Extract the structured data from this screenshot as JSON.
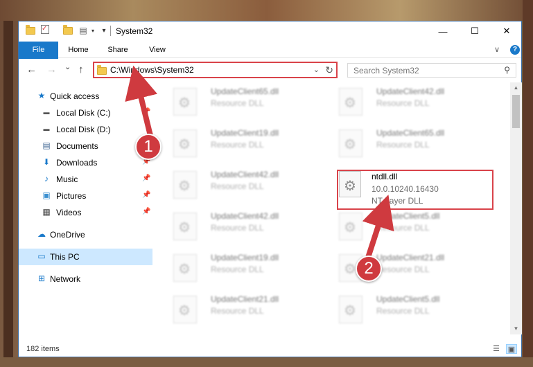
{
  "window": {
    "title": "System32",
    "minimize_label": "—",
    "maximize_label": "☐",
    "close_label": "✕"
  },
  "ribbon": {
    "tabs": [
      "File",
      "Home",
      "Share",
      "View"
    ],
    "help_label": "?",
    "collapse_label": "∨"
  },
  "nav": {
    "back_label": "←",
    "forward_label": "→",
    "recent_label": "⌄",
    "up_label": "↑",
    "address": "C:\\Windows\\System32",
    "dropdown_label": "⌄",
    "refresh_label": "↻",
    "search_placeholder": "Search System32",
    "search_icon_label": "⚲"
  },
  "sidebar": {
    "items": [
      {
        "label": "Quick access",
        "icon": "★"
      },
      {
        "label": "Local Disk (C:)",
        "icon": "▬"
      },
      {
        "label": "Local Disk (D:)",
        "icon": "▬"
      },
      {
        "label": "Documents",
        "icon": "▤"
      },
      {
        "label": "Downloads",
        "icon": "⬇"
      },
      {
        "label": "Music",
        "icon": "♪"
      },
      {
        "label": "Pictures",
        "icon": "▣"
      },
      {
        "label": "Videos",
        "icon": "▦"
      },
      {
        "label": "OneDrive",
        "icon": "☁"
      },
      {
        "label": "This PC",
        "icon": "▭"
      },
      {
        "label": "Network",
        "icon": "⊞"
      }
    ],
    "pin_label": "📌"
  },
  "files": [
    {
      "name": "UpdateClient65.dll",
      "desc": "Resource DLL"
    },
    {
      "name": "UpdateClient42.dll",
      "desc": "Resource DLL"
    },
    {
      "name": "UpdateClient19.dll",
      "desc": "Resource DLL"
    },
    {
      "name": "UpdateClient65.dll",
      "desc": "Resource DLL"
    },
    {
      "name": "UpdateClient42.dll",
      "desc": "Resource DLL"
    },
    {
      "name": "ntdll.dll",
      "desc": "10.0.10240.16430",
      "desc2": "NT Layer DLL"
    },
    {
      "name": "UpdateClient42.dll",
      "desc": "Resource DLL"
    },
    {
      "name": "UpdateClient5.dll",
      "desc": "Resource DLL"
    },
    {
      "name": "UpdateClient19.dll",
      "desc": "Resource DLL"
    },
    {
      "name": "UpdateClient21.dll",
      "desc": "Resource DLL"
    },
    {
      "name": "UpdateClient21.dll",
      "desc": "Resource DLL"
    },
    {
      "name": "UpdateClient5.dll",
      "desc": "Resource DLL"
    }
  ],
  "status": {
    "count": "182 items"
  },
  "annotations": {
    "badge1": "1",
    "badge2": "2"
  },
  "colors": {
    "accent": "#1979ca",
    "highlight": "#d9434a",
    "selection": "#cde8ff"
  }
}
